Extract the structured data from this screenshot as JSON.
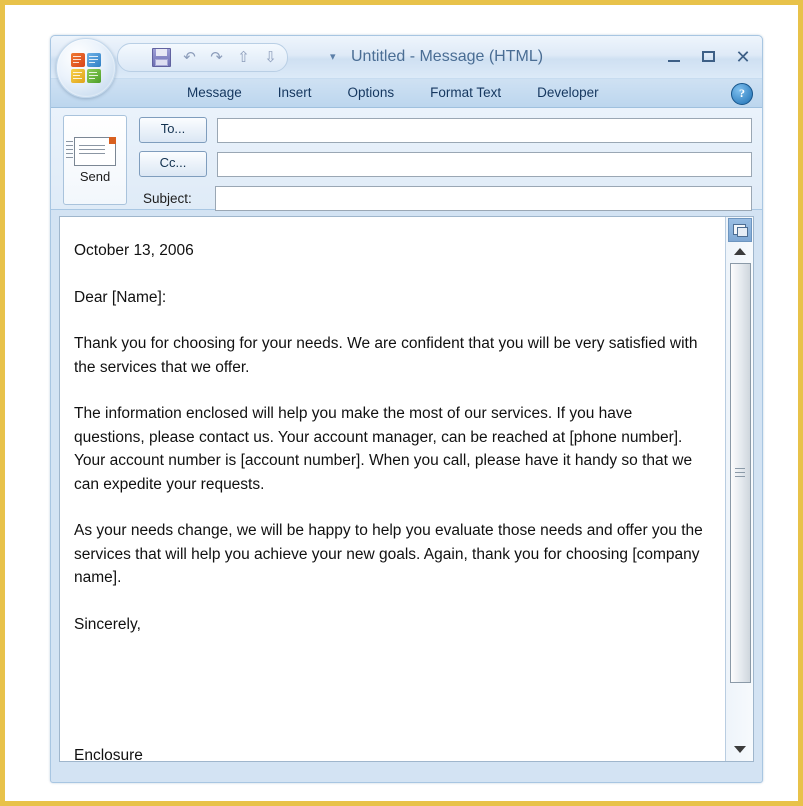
{
  "window": {
    "title": "Untitled - Message (HTML)",
    "office_button": "office-orb",
    "min_label": "Minimize",
    "max_label": "Maximize",
    "close_label": "Close"
  },
  "quick_access": {
    "items": [
      {
        "name": "save-icon",
        "label": "Save"
      },
      {
        "name": "undo-icon",
        "label": "Undo",
        "glyph": "↶"
      },
      {
        "name": "redo-icon",
        "label": "Redo",
        "glyph": "↷"
      },
      {
        "name": "previous-item-icon",
        "label": "Previous Item",
        "glyph": "⇧"
      },
      {
        "name": "next-item-icon",
        "label": "Next Item",
        "glyph": "⇩"
      }
    ],
    "customize_glyph": "▾"
  },
  "ribbon": {
    "tabs": [
      {
        "label": "Message",
        "active": true
      },
      {
        "label": "Insert",
        "active": false
      },
      {
        "label": "Options",
        "active": false
      },
      {
        "label": "Format Text",
        "active": false
      },
      {
        "label": "Developer",
        "active": false
      }
    ],
    "help_label": "?"
  },
  "compose": {
    "send_label": "Send",
    "to_label": "To...",
    "cc_label": "Cc...",
    "subject_label": "Subject:",
    "to_value": "",
    "cc_value": "",
    "subject_value": "",
    "to_placeholder": "",
    "cc_placeholder": "",
    "subject_placeholder": ""
  },
  "body": {
    "date": "October 13, 2006",
    "salutation": "Dear [Name]:",
    "paragraphs": [
      "Thank you for choosing for your needs. We are confident that you will be very satisfied with the services that we offer.",
      "The information enclosed will help you make the most of our services. If you have questions, please contact us. Your account manager, can be reached at [phone number]. Your account number is [account number]. When you call, please have it handy so that we can expedite your requests.",
      "As your needs change, we will be happy to help you evaluate those needs and offer you the services that will help you achieve your new goals. Again, thank you for choosing [company name]."
    ],
    "closing": "Sincerely,",
    "enclosure": "Enclosure"
  },
  "scrollbar": {
    "split_label": "Split / Select Browse Object",
    "up_glyph": "▲",
    "down_glyph": "▼"
  },
  "colors": {
    "outer_border": "#e8c24a",
    "window_chrome": "#d3e3f3",
    "tab_strip": "#cfe1f3",
    "tab_text": "#15375f",
    "title_text": "#4a6d94",
    "body_text": "#111111"
  }
}
